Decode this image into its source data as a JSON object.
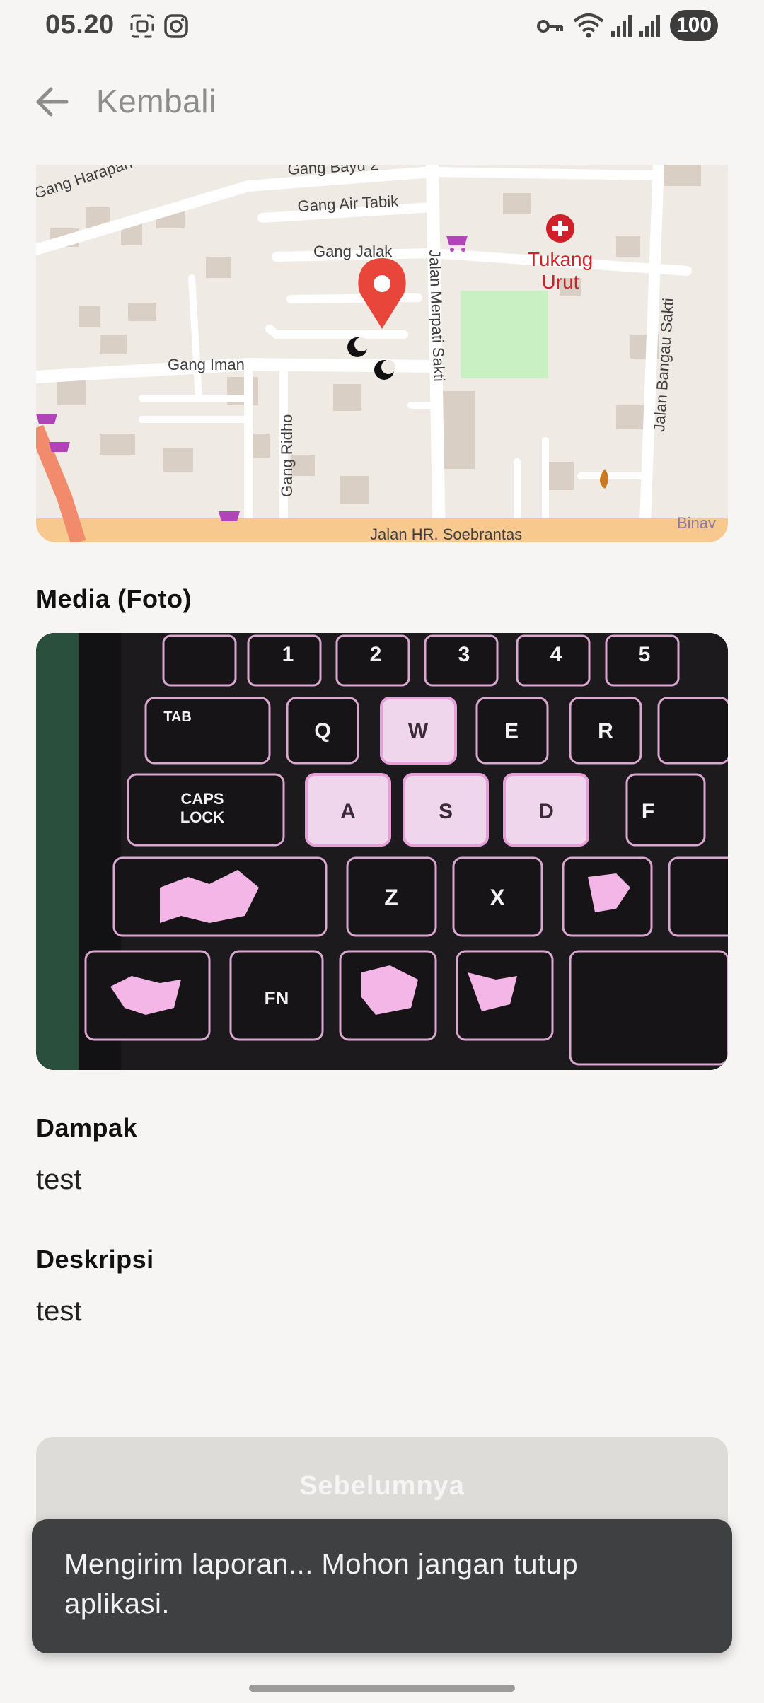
{
  "status_bar": {
    "time": "05.20",
    "battery": "100",
    "icons": [
      "screenshot-icon",
      "instagram-icon",
      "vpn-key-icon",
      "wifi-icon",
      "signal-icon",
      "signal-icon",
      "battery-icon"
    ]
  },
  "app_bar": {
    "back_label": "Kembali",
    "back_icon": "arrow-left-icon"
  },
  "map": {
    "streets": {
      "s1": "Gang Harapan",
      "s2": "Gang Bayu 2",
      "s3": "Gang Air Tabik",
      "s4": "Gang Jalak",
      "s5": "Gang Iman",
      "s6": "Gang Ridho",
      "s7": "Jalan Merpati Sakti",
      "s8": "Jalan Bangau Sakti",
      "s9": "Jalan HR. Soebrantas",
      "s10": "Binav"
    },
    "poi_line1": "Tukang",
    "poi_line2": "Urut",
    "marker_icon": "location-pin-icon"
  },
  "media": {
    "label": "Media (Foto)",
    "keys": {
      "k1": "1",
      "k2": "2",
      "k3": "3",
      "k4": "4",
      "k5": "5",
      "tab": "TAB",
      "q": "Q",
      "w": "W",
      "e": "E",
      "r": "R",
      "caps1": "CAPS",
      "caps2": "LOCK",
      "a": "A",
      "s": "S",
      "d": "D",
      "f": "F",
      "z": "Z",
      "x": "X",
      "fn": "FN"
    }
  },
  "impact": {
    "label": "Dampak",
    "value": "test"
  },
  "description": {
    "label": "Deskripsi",
    "value": "test"
  },
  "prev_button": {
    "label": "Sebelumnya"
  },
  "snackbar": {
    "message": "Mengirim laporan... Mohon jangan tutup aplikasi."
  },
  "colors": {
    "background": "#f6f5f3",
    "snackbar": "#3e4041",
    "button_disabled": "#dddcd8",
    "map_pin": "#e8463a"
  }
}
